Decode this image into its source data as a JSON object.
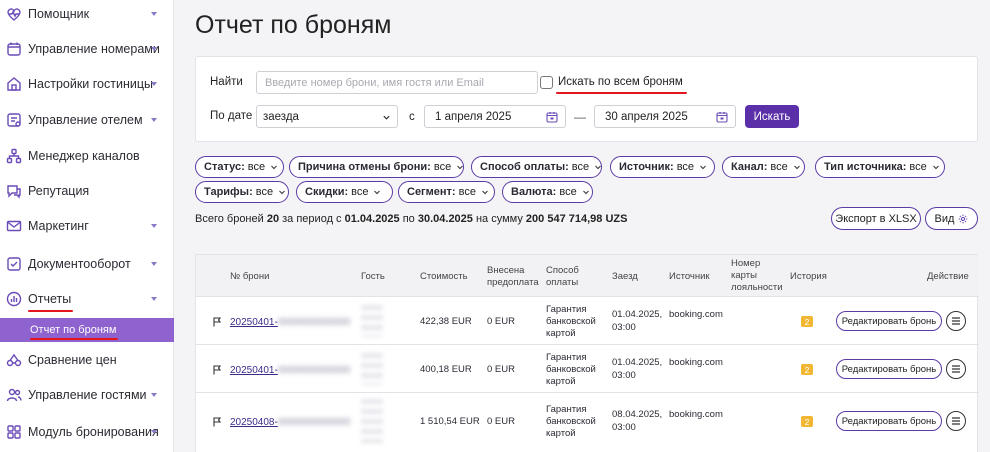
{
  "sidebar": {
    "items": [
      {
        "label": "Помощник",
        "icon": "heart-monitor-icon",
        "chevron": true
      },
      {
        "label": "Управление номерами",
        "icon": "calendar-icon",
        "chevron": true
      },
      {
        "label": "Настройки гостиницы",
        "icon": "house-icon",
        "chevron": true
      },
      {
        "label": "Управление отелем",
        "icon": "clipboard-icon",
        "chevron": true
      },
      {
        "label": "Менеджер каналов",
        "icon": "network-icon",
        "chevron": false
      },
      {
        "label": "Репутация",
        "icon": "chat-icon",
        "chevron": false
      },
      {
        "label": "Маркетинг",
        "icon": "mail-icon",
        "chevron": true
      },
      {
        "label": "Документооборот",
        "icon": "checklist-icon",
        "chevron": true
      },
      {
        "label": "Отчеты",
        "icon": "chart-icon",
        "chevron": true
      },
      {
        "label": "Сравнение цен",
        "icon": "scales-icon",
        "chevron": false
      },
      {
        "label": "Управление гостями",
        "icon": "users-icon",
        "chevron": true
      },
      {
        "label": "Модуль бронирования",
        "icon": "grid-icon",
        "chevron": true
      }
    ],
    "subitem": "Отчет по броням"
  },
  "page": {
    "title": "Отчет по броням"
  },
  "filters": {
    "find_label": "Найти",
    "search_placeholder": "Введите номер брони, имя гостя или Email",
    "search_all_label": "Искать по всем броням",
    "date_label": "По дате",
    "date_type": "заезда",
    "from_label": "с",
    "date_from": "1 апреля 2025",
    "date_to": "30 апреля 2025",
    "search_button": "Искать"
  },
  "chips": [
    {
      "name": "Статус:",
      "value": "все"
    },
    {
      "name": "Причина отмены брони:",
      "value": "все"
    },
    {
      "name": "Способ оплаты:",
      "value": "все"
    },
    {
      "name": "Источник:",
      "value": "все"
    },
    {
      "name": "Канал:",
      "value": "все"
    },
    {
      "name": "Тип источника:",
      "value": "все"
    },
    {
      "name": "Тарифы:",
      "value": "все"
    },
    {
      "name": "Скидки:",
      "value": "все"
    },
    {
      "name": "Сегмент:",
      "value": "все"
    },
    {
      "name": "Валюта:",
      "value": "все"
    }
  ],
  "summary": {
    "t1": "Всего броней ",
    "count": "20",
    "t2": " за период с ",
    "from": "01.04.2025",
    "t3": " по ",
    "to": "30.04.2025",
    "t4": " на сумму ",
    "amount": "200 547 714,98 UZS"
  },
  "actions": {
    "export": "Экспорт в XLSX",
    "view": "Вид"
  },
  "table": {
    "headers": {
      "num": "№ брони",
      "guest": "Гость",
      "cost": "Стоимость",
      "prepay": "Внесена предоплата",
      "payment": "Способ оплаты",
      "checkin": "Заезд",
      "source": "Источник",
      "loyalty": "Номер карты лояльности",
      "history": "История",
      "action": "Действие"
    },
    "rows": [
      {
        "num": "20250401-",
        "num_hidden": "0000000000000",
        "cost": "422,38 EUR",
        "prepay": "0 EUR",
        "payment": "Гарантия банковской картой",
        "checkin_date": "01.04.2025,",
        "checkin_time": "03:00",
        "source": "booking.com",
        "history": "2",
        "edit": "Редактировать бронь"
      },
      {
        "num": "20250401-",
        "num_hidden": "0000000000000",
        "cost": "400,18 EUR",
        "prepay": "0 EUR",
        "payment": "Гарантия банковской картой",
        "checkin_date": "01.04.2025,",
        "checkin_time": "03:00",
        "source": "booking.com",
        "history": "2",
        "edit": "Редактировать бронь"
      },
      {
        "num": "20250408-",
        "num_hidden": "0000000000000",
        "cost": "1 510,54 EUR",
        "prepay": "0 EUR",
        "payment": "Гарантия банковской картой",
        "checkin_date": "08.04.2025,",
        "checkin_time": "03:00",
        "source": "booking.com",
        "history": "2",
        "edit": "Редактировать бронь"
      }
    ]
  },
  "colors": {
    "accent": "#5a2fa8",
    "sidebar_active": "#8e63cf",
    "highlight_line": "#e3161c",
    "badge": "#f1b733"
  }
}
